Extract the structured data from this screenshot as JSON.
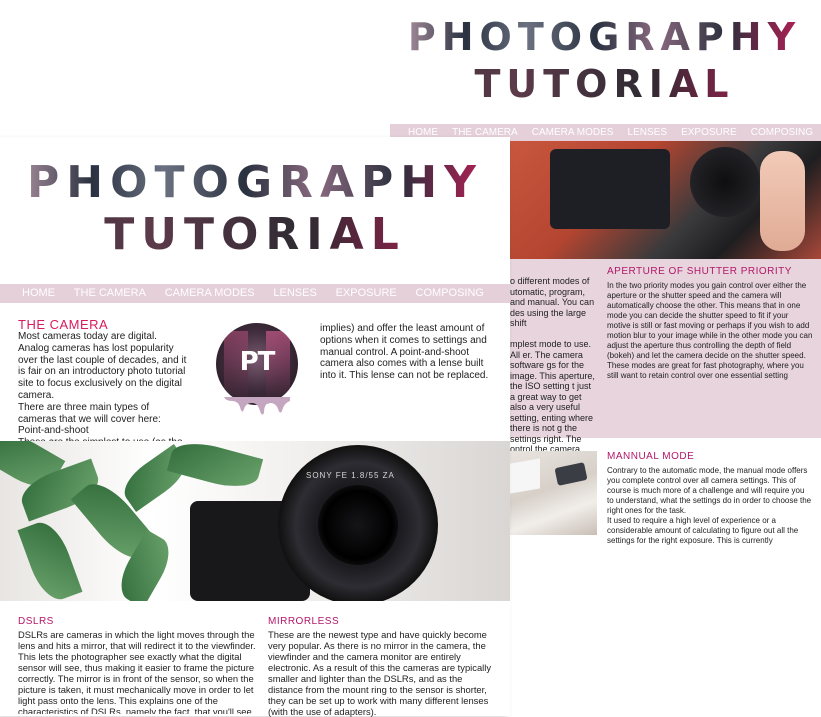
{
  "back_page": {
    "title_line1": "PHOTOGRAPHY",
    "title_line2": "TUTORIAL",
    "nav": [
      "HOME",
      "THE CAMERA",
      "CAMERA MODES",
      "LENSES",
      "EXPOSURE",
      "COMPOSING"
    ],
    "fragment_text": "o different modes of utomatic, program, and manual. You can des using the large shift\n\nmplest mode to use. All er. The camera software gs for the image. This aperture, the ISO setting t just a great way to get also a very useful setting, enting where there is not g the settings right. The ontrol the camera",
    "aperture": {
      "heading": "APERTURE OF SHUTTER PRIORITY",
      "body": "In the two priority modes you gain control over either the aperture or the shutter speed and the camera will automatically choose the other. This means that in one mode you can decide the shutter speed to fit if your motive is still or fast moving or perhaps if you wish to add motion blur to your image while in the other mode you can adjust the aperture thus controlling the depth of field (bokeh) and let the camera decide on the shutter speed. These modes are great for fast photography, where you still want to retain control over one essential setting"
    },
    "manual": {
      "heading": "MANNUAL MODE",
      "body": "Contrary to the automatic mode, the manual mode offers you complete control over all camera settings. This of course is much more of a challenge and will require you to understand, what the settings do in order to choose the right ones for the task.\nIt used to require a high level of experience or a considerable amount of calculating to figure out all the settings for the right exposure. This is currently"
    }
  },
  "front_page": {
    "title_line1": "PHOTOGRAPHY",
    "title_line2": "TUTORIAL",
    "nav": [
      "HOME",
      "THE CAMERA",
      "CAMERA MODES",
      "LENSES",
      "EXPOSURE",
      "COMPOSING"
    ],
    "camera": {
      "heading": "THE CAMERA",
      "col1": "Most cameras today are digital. Analog cameras has lost popularity over the last couple of decades, and it is fair on an introductory photo tutorial site to focus exclusively on the digital camera.\nThere are three main types of cameras that we will cover here:\nPoint-and-shoot\nThese are the simplest to use (as the name",
      "col3": "implies) and offer the least amount of options when it comes to settings and manual control. A point-and-shoot camera also comes with a lense built into it. This lense can not be replaced."
    },
    "logo_text": "PT",
    "lens_text": "SONY FE 1.8/55 ZA",
    "dslrs": {
      "heading": "DSLRS",
      "body": "DSLRs are cameras in which the light moves through the lens and hits a mirror, that will redirect it to the viewfinder. This lets the photographer see exactly what the digital sensor will see, thus making it easier to frame the picture correctly. The mirror is in front of the sensor, so when the picture is taken, it must mechanically move in order to let light pass onto the lens. This explains one of the characteristics of DSLRs, namely the fact, that you'll see a short, black flickering in the viewfinder just as the picture is taken."
    },
    "mirrorless": {
      "heading": "MIRRORLESS",
      "body": "These are the newest type and have quickly become very popular. As there is no mirror in the camera, the viewfinder and the camera monitor are entirely electronic. As a result of this the cameras are typically smaller and lighter than the DSLRs, and as the distance from the mount ring to the sensor is shorter, they can be set up to work with many different lenses (with the use of adapters)."
    }
  },
  "colors": {
    "accent": "#d81b5d",
    "heading_pink": "#b3176a",
    "nav_bg": "#e5cfd8",
    "panel_bg": "#e7d4dc"
  }
}
